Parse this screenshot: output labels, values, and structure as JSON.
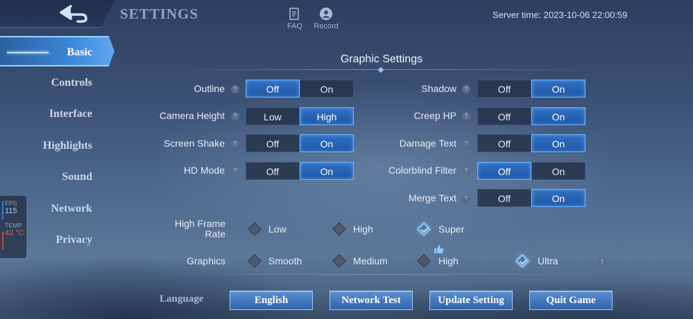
{
  "header": {
    "title": "SETTINGS",
    "faq_label": "FAQ",
    "record_label": "Record",
    "server_time": "Server time: 2023-10-06 22:00:59"
  },
  "sidebar": {
    "items": [
      {
        "label": "Basic",
        "active": true
      },
      {
        "label": "Controls"
      },
      {
        "label": "Interface"
      },
      {
        "label": "Highlights"
      },
      {
        "label": "Sound"
      },
      {
        "label": "Network"
      },
      {
        "label": "Privacy"
      }
    ]
  },
  "stats": {
    "fps_label": "FPS",
    "fps_value": "115",
    "temp_label": "TEMP",
    "temp_value": "42 °C"
  },
  "graphic": {
    "title": "Graphic Settings",
    "help": "?",
    "left": [
      {
        "label": "Outline",
        "options": [
          "Off",
          "On"
        ],
        "selected": "Off"
      },
      {
        "label": "Camera Height",
        "options": [
          "Low",
          "High"
        ],
        "selected": "High"
      },
      {
        "label": "Screen Shake",
        "options": [
          "Off",
          "On"
        ],
        "selected": "On"
      },
      {
        "label": "HD Mode",
        "options": [
          "Off",
          "On"
        ],
        "selected": "On"
      }
    ],
    "right": [
      {
        "label": "Shadow",
        "options": [
          "Off",
          "On"
        ],
        "selected": "On"
      },
      {
        "label": "Creep HP",
        "options": [
          "Off",
          "On"
        ],
        "selected": "On"
      },
      {
        "label": "Damage Text",
        "options": [
          "Off",
          "On"
        ],
        "selected": "On"
      },
      {
        "label": "Colorblind Filter",
        "options": [
          "Off",
          "On"
        ],
        "selected": "Off"
      },
      {
        "label": "Merge Text",
        "options": [
          "Off",
          "On"
        ],
        "selected": "On"
      }
    ],
    "frame_rate": {
      "label_line1": "High Frame",
      "label_line2": "Rate",
      "options": [
        "Low",
        "High",
        "Super"
      ],
      "selected": "Super"
    },
    "graphics": {
      "label": "Graphics",
      "options": [
        "Smooth",
        "Medium",
        "High",
        "Ultra"
      ],
      "selected": "Ultra",
      "recommended": "High"
    }
  },
  "footer": {
    "language_label": "Language",
    "buttons": [
      "English",
      "Network Test",
      "Update Setting",
      "Quit Game"
    ]
  },
  "colors": {
    "accent": "#2f6fc2",
    "highlight": "#6fb3ff"
  }
}
